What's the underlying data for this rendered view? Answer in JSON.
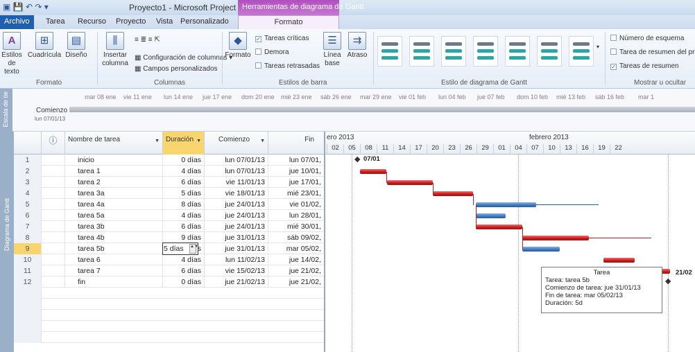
{
  "window": {
    "title": "Proyecto1 - Microsoft Project",
    "context_tool": "Herramientas de diagrama de Gantt"
  },
  "tabs": [
    {
      "label": "Archivo"
    },
    {
      "label": "Tarea"
    },
    {
      "label": "Recurso"
    },
    {
      "label": "Proyecto"
    },
    {
      "label": "Vista"
    },
    {
      "label": "Personalizado"
    },
    {
      "label": "Formato"
    }
  ],
  "ribbon": {
    "estilos_texto": "Estilos de texto",
    "cuadricula": "Cuadrícula",
    "diseno": "Diseño",
    "insertar_columna": "Insertar columna",
    "config_columnas": "Configuración de columnas",
    "campos_personalizados": "Campos personalizados",
    "formato": "Formato",
    "tareas_criticas": "Tareas críticas",
    "demora": "Demora",
    "tareas_retrasadas": "Tareas retrasadas",
    "linea_base": "Línea base",
    "atraso": "Atraso",
    "numero_esquema": "Número de esquema",
    "tarea_resumen_proyecto": "Tarea de resumen del pro",
    "tareas_resumen": "Tareas de resumen",
    "groups": {
      "formato": "Formato",
      "columnas": "Columnas",
      "estilos_barra": "Estilos de barra",
      "estilo_gantt": "Estilo de diagrama de Gantt",
      "mostrar_ocultar": "Mostrar u ocultar"
    }
  },
  "timeline": {
    "side_label": "Escala de tie",
    "start_label": "Comienzo",
    "start_date": "lun 07/01/13",
    "dates": [
      "mar 08 ene",
      "vie 11 ene",
      "lun 14 ene",
      "jue 17 ene",
      "dom 20 ene",
      "mié 23 ene",
      "sáb 26 ene",
      "mar 29 ene",
      "vie 01 feb",
      "lun 04 feb",
      "jue 07 feb",
      "dom 10 feb",
      "mié 13 feb",
      "sáb 16 feb",
      "mar 1"
    ]
  },
  "gantt_side_label": "Diagrama de Gantt",
  "grid": {
    "headers": {
      "info": "ⓘ",
      "name": "Nombre de tarea",
      "duration": "Duración",
      "start": "Comienzo",
      "finish": "Fin"
    },
    "rows": [
      {
        "id": "1",
        "name": "inicio",
        "duration": "0 días",
        "start": "lun 07/01/13",
        "finish": "lun 07/01,"
      },
      {
        "id": "2",
        "name": "tarea 1",
        "duration": "4 días",
        "start": "lun 07/01/13",
        "finish": "jue 10/01,"
      },
      {
        "id": "3",
        "name": "tarea 2",
        "duration": "6 días",
        "start": "vie 11/01/13",
        "finish": "jue 17/01,"
      },
      {
        "id": "4",
        "name": "tarea 3a",
        "duration": "5 días",
        "start": "vie 18/01/13",
        "finish": "mié 23/01,"
      },
      {
        "id": "5",
        "name": "tarea 4a",
        "duration": "8 días",
        "start": "jue 24/01/13",
        "finish": "vie 01/02,"
      },
      {
        "id": "6",
        "name": "tarea 5a",
        "duration": "4 días",
        "start": "jue 24/01/13",
        "finish": "lun 28/01,"
      },
      {
        "id": "7",
        "name": "tarea 3b",
        "duration": "6 días",
        "start": "jue 24/01/13",
        "finish": "mié 30/01,"
      },
      {
        "id": "8",
        "name": "tarea 4b",
        "duration": "9 días",
        "start": "jue 31/01/13",
        "finish": "sáb 09/02,"
      },
      {
        "id": "9",
        "name": "tarea 5b",
        "duration": "5 días",
        "start": "jue 31/01/13",
        "finish": "mar 05/02,"
      },
      {
        "id": "10",
        "name": "tarea 6",
        "duration": "4 días",
        "start": "lun 11/02/13",
        "finish": "jue 14/02,"
      },
      {
        "id": "11",
        "name": "tarea 7",
        "duration": "6 días",
        "start": "vie 15/02/13",
        "finish": "jue 21/02,"
      },
      {
        "id": "12",
        "name": "fin",
        "duration": "0 días",
        "start": "jue 21/02/13",
        "finish": "jue 21/02,"
      }
    ],
    "editing_value": "5 días"
  },
  "gantt": {
    "month1": "ero 2013",
    "month2": "febrero 2013",
    "days": [
      "02",
      "05",
      "08",
      "11",
      "14",
      "17",
      "20",
      "23",
      "26",
      "29",
      "01",
      "04",
      "07",
      "10",
      "13",
      "16",
      "19",
      "22"
    ],
    "ms_start_label": "07/01",
    "ms_end_label": "21/02",
    "tooltip": {
      "title": "Tarea",
      "task": "Tarea: tarea 5b",
      "start": "Comienzo de tarea: jue 31/01/13",
      "finish": "Fin de tarea: mar 05/02/13",
      "duration": "Duración: 5d"
    }
  }
}
